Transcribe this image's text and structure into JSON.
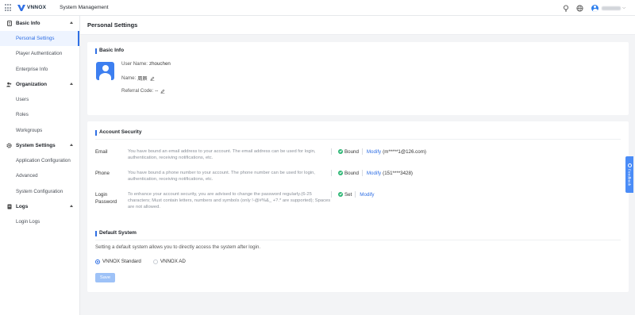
{
  "header": {
    "brand": "VNNOX",
    "app_title": "System Management",
    "user_display": "•••••"
  },
  "sidebar": {
    "groups": [
      {
        "label": "Basic Info",
        "icon": "document-icon",
        "items": [
          "Personal Settings",
          "Player Authentication",
          "Enterprise Info"
        ]
      },
      {
        "label": "Organization",
        "icon": "user-group-icon",
        "items": [
          "Users",
          "Roles",
          "Workgroups"
        ]
      },
      {
        "label": "System Settings",
        "icon": "gear-icon",
        "items": [
          "Application Configuration",
          "Advanced",
          "System Configuration"
        ]
      },
      {
        "label": "Logs",
        "icon": "log-icon",
        "items": [
          "Login Logs"
        ]
      }
    ],
    "active_item": "Personal Settings"
  },
  "page": {
    "title": "Personal Settings"
  },
  "basic_info": {
    "title": "Basic Info",
    "user_name_label": "User Name:",
    "user_name": "zhouchen",
    "name_label": "Name:",
    "name": "周辰",
    "referral_label": "Referral Code:",
    "referral_code": "--"
  },
  "account_security": {
    "title": "Account Security",
    "rows": [
      {
        "label": "Email",
        "desc": "You have bound an email address to your account. The email address can be used for login, authentication, receiving notifications, etc.",
        "status": "Bound",
        "action": "Modify",
        "detail": "(m*****1@126.com)"
      },
      {
        "label": "Phone",
        "desc": "You have bound a phone number to your account. The phone number can be used for login, authentication, receiving notifications, etc.",
        "status": "Bound",
        "action": "Modify",
        "detail": "(151****3428)"
      },
      {
        "label": "Login Password",
        "desc": "To enhance your account security, you are advised to change the password regularly.(6-25 characters; Must contain letters, numbers and symbols (only !-@#%&_ +?.* are supported); Spaces are not allowed.",
        "status": "Set",
        "action": "Modify",
        "detail": ""
      }
    ]
  },
  "default_system": {
    "title": "Default System",
    "desc": "Setting a default system allows you to directly access the system after login.",
    "options": [
      "VNNOX Standard",
      "VNNOX AD"
    ],
    "selected": "VNNOX Standard",
    "save_label": "Save"
  },
  "float_tab": {
    "label": "Feedback"
  },
  "colors": {
    "accent": "#2f6fe4",
    "success": "#2bb673",
    "save_disabled": "#9ec2f7"
  }
}
